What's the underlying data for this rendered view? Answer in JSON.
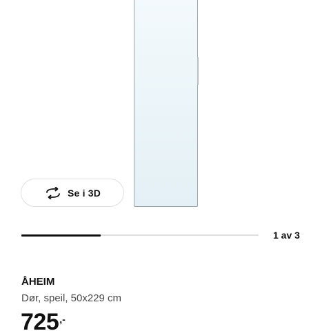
{
  "gallery": {
    "view_3d_label": "Se i 3D",
    "page_indicator": "1 av 3",
    "progress_fraction": 0.333
  },
  "product": {
    "name": "ÅHEIM",
    "description": "Dør, speil, 50x229 cm",
    "price": "725",
    "price_suffix": ",-"
  },
  "icons": {
    "view_3d": "rotate-3d-icon"
  }
}
